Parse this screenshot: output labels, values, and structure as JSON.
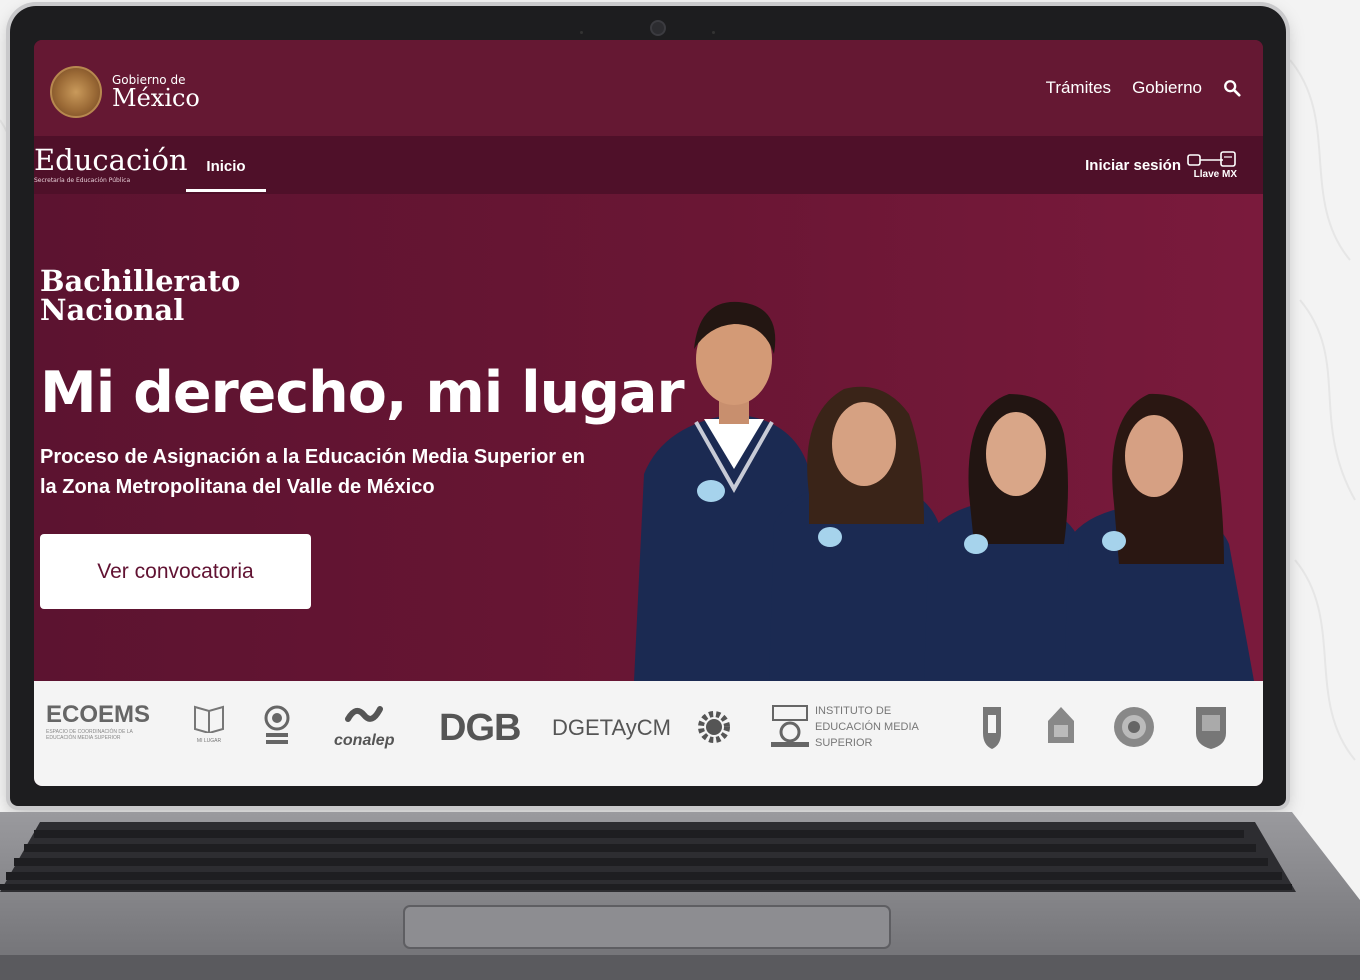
{
  "header": {
    "gov_small": "Gobierno de",
    "gov_big": "México",
    "nav": [
      "Trámites",
      "Gobierno"
    ]
  },
  "subnav": {
    "brand_title": "Educación",
    "brand_sub": "Secretaría de Educación Pública",
    "tab": "Inicio",
    "login_label": "Iniciar sesión",
    "llave_label": "Llave MX"
  },
  "hero": {
    "kicker": "Bachillerato\nNacional",
    "title": "Mi derecho, mi lugar",
    "description": "Proceso de Asignación a la Educación Media Superior en la Zona Metropolitana del Valle de México",
    "button": "Ver convocatoria"
  },
  "partners": {
    "ecoems": "ECOEMS",
    "ecoems_sub": "ESPACIO DE COORDINACIÓN DE LA EDUCACIÓN MEDIA SUPERIOR",
    "milugar": "MI LUGAR",
    "conalep": "conalep",
    "dgb": "DGB",
    "dgetaycm": "DGETAyCM",
    "ipn": "IPN",
    "iems": "INSTITUTO DE EDUCACIÓN MEDIA SUPERIOR"
  },
  "colors": {
    "brand_primary": "#611232",
    "brand_header": "#651833",
    "brand_subbar": "#4f1029",
    "uniform_navy": "#1b2a52"
  },
  "icons": [
    "search-icon",
    "gov-seal-icon",
    "llave-mx-icon"
  ]
}
